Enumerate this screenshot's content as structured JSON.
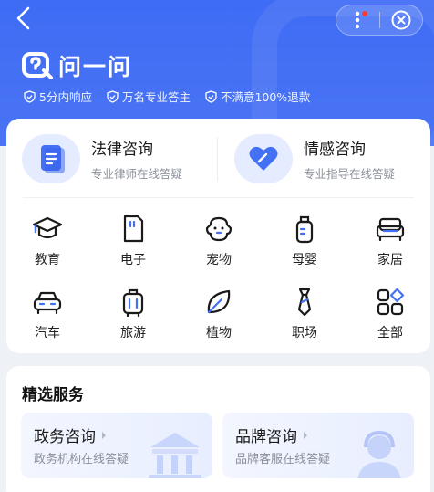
{
  "header": {
    "logo_text": "问一问",
    "features": [
      "5分内响应",
      "万名专业答主",
      "不满意100%退款"
    ]
  },
  "top_services": [
    {
      "title": "法律咨询",
      "subtitle": "专业律师在线答疑",
      "icon": "document-icon"
    },
    {
      "title": "情感咨询",
      "subtitle": "专业指导在线答疑",
      "icon": "heart-icon"
    }
  ],
  "categories": [
    {
      "label": "教育",
      "icon": "graduation-cap-icon"
    },
    {
      "label": "电子",
      "icon": "sim-card-icon"
    },
    {
      "label": "宠物",
      "icon": "pet-icon"
    },
    {
      "label": "母婴",
      "icon": "baby-bottle-icon"
    },
    {
      "label": "家居",
      "icon": "sofa-icon"
    },
    {
      "label": "汽车",
      "icon": "car-icon"
    },
    {
      "label": "旅游",
      "icon": "luggage-icon"
    },
    {
      "label": "植物",
      "icon": "leaf-icon"
    },
    {
      "label": "职场",
      "icon": "tie-icon"
    },
    {
      "label": "全部",
      "icon": "grid-icon"
    }
  ],
  "featured": {
    "title": "精选服务",
    "items": [
      {
        "title": "政务咨询",
        "subtitle": "政务机构在线答疑",
        "icon": "government-building-icon"
      },
      {
        "title": "品牌咨询",
        "subtitle": "品牌客服在线答疑",
        "icon": "customer-service-icon"
      }
    ]
  },
  "colors": {
    "brand": "#4470f4",
    "accent_light": "#e6ecff",
    "red_dot": "#ff3b30"
  }
}
